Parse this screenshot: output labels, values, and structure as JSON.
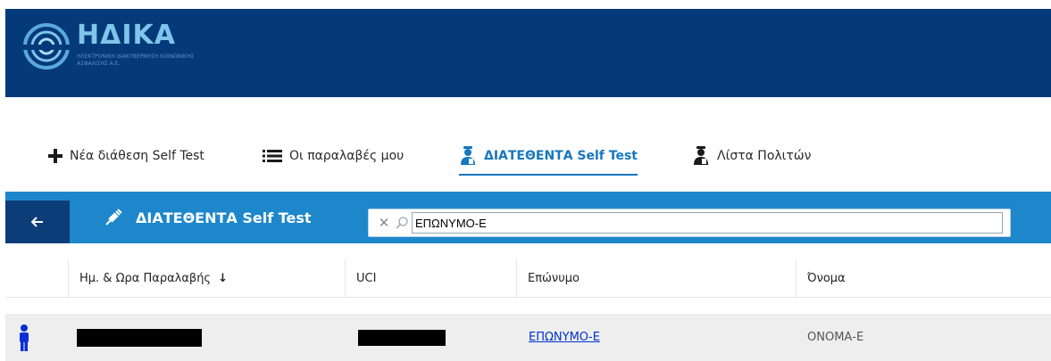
{
  "header": {
    "logo_word": "ΗΔΙΚΑ",
    "logo_sub": "ΗΛΕΚΤΡΟΝΙΚΗ ΔΙΑΚΥΒΕΡΝΗΣΗ ΚΟΙΝΩΝΙΚΗΣ ΑΣΦΑΛΙΣΗΣ Α.Ε."
  },
  "nav": {
    "items": [
      {
        "label": "Νέα διάθεση Self Test",
        "icon": "plus-icon"
      },
      {
        "label": "Οι παραλαβές μου",
        "icon": "list-icon"
      },
      {
        "label": "ΔΙΑΤΕΘΕΝΤΑ Self Test",
        "icon": "user-test-icon",
        "active": true
      },
      {
        "label": "Λίστα Πολιτών",
        "icon": "user-test-icon"
      }
    ]
  },
  "toolbar": {
    "title": "ΔΙΑΤΕΘΕΝΤΑ Self Test",
    "search_value": "ΕΠΩΝΥΜΟ-Ε"
  },
  "table": {
    "columns": [
      "Ημ. & Ωρα Παραλαβής",
      "UCI",
      "Επώνυμο",
      "Όνομα"
    ],
    "sort_indicator": "↓",
    "rows": [
      {
        "datetime": "",
        "uci": "",
        "surname": "ΕΠΩΝΥΜΟ-Ε",
        "name": "ΟΝΟΜΑ-Ε"
      }
    ]
  },
  "colors": {
    "header_bg": "#04397a",
    "toolbar_bg": "#1e87cb",
    "back_bg": "#0c3d78",
    "accent": "#1677bf",
    "row_bg": "#eeeeee",
    "person_icon": "#0a2fd4"
  }
}
